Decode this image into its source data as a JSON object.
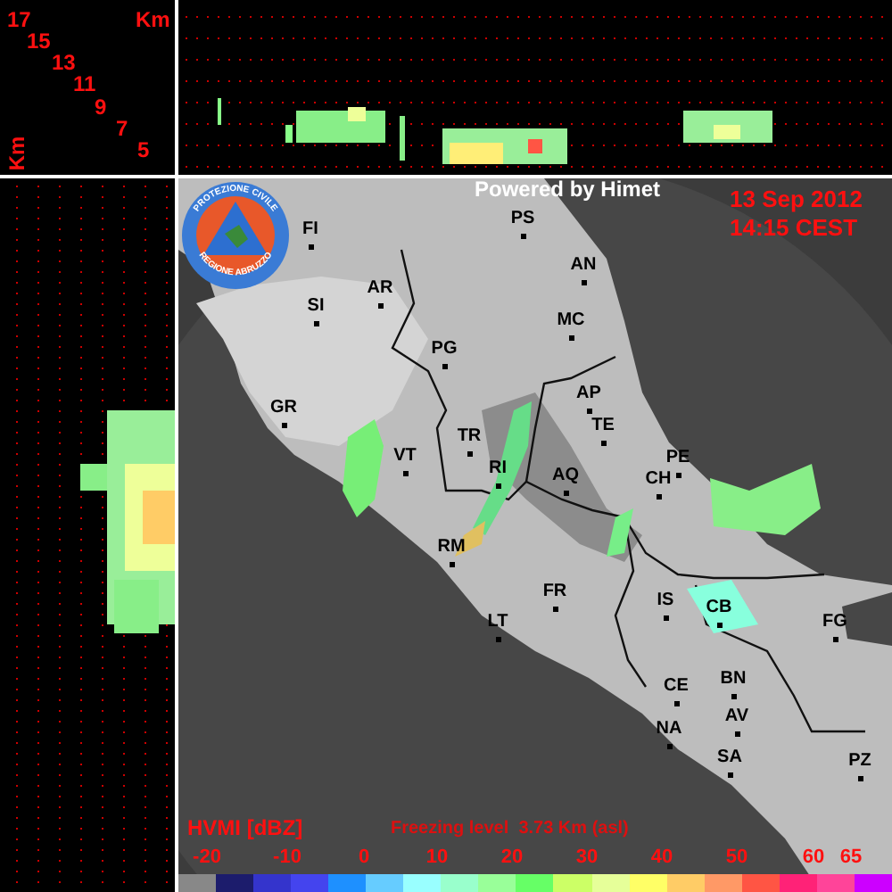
{
  "corner": {
    "unit_top": "Km",
    "unit_side": "Km",
    "heights": [
      "17",
      "15",
      "13",
      "11",
      "9",
      "7",
      "5"
    ]
  },
  "header": {
    "credit": "Powered by Himet",
    "date": "13 Sep 2012",
    "time": "14:15 CEST"
  },
  "logo": {
    "top_text": "PROTEZIONE CIVILE",
    "bottom_text": "REGIONE ABRUZZO"
  },
  "cities": [
    "FI",
    "SI",
    "AR",
    "PS",
    "AN",
    "MC",
    "PG",
    "GR",
    "TR",
    "AP",
    "TE",
    "VT",
    "RI",
    "AQ",
    "PE",
    "CH",
    "RM",
    "FR",
    "IS",
    "CB",
    "FG",
    "LT",
    "CE",
    "BN",
    "NA",
    "AV",
    "SA",
    "PZ"
  ],
  "footer": {
    "product": "HVMI [dBZ]",
    "freezing_level": "Freezing level  3.73 Km (asl)"
  },
  "legend": {
    "ticks": [
      "-20",
      "-10",
      "0",
      "10",
      "20",
      "30",
      "40",
      "50",
      "60",
      "65"
    ],
    "swatches": [
      {
        "color": "#888888"
      },
      {
        "color": "#1c1c6c"
      },
      {
        "color": "#3434cc"
      },
      {
        "color": "#4444ee"
      },
      {
        "color": "#1e90ff"
      },
      {
        "color": "#66ccff"
      },
      {
        "color": "#99ffff"
      },
      {
        "color": "#99ffcc"
      },
      {
        "color": "#99ff99"
      },
      {
        "color": "#66ff66"
      },
      {
        "color": "#ccff66"
      },
      {
        "color": "#e6ff99"
      },
      {
        "color": "#ffff66"
      },
      {
        "color": "#ffcc66"
      },
      {
        "color": "#ff9966"
      },
      {
        "color": "#ff5544"
      },
      {
        "color": "#ff2277"
      },
      {
        "color": "#ff4499"
      },
      {
        "color": "#cc00ff"
      }
    ]
  }
}
